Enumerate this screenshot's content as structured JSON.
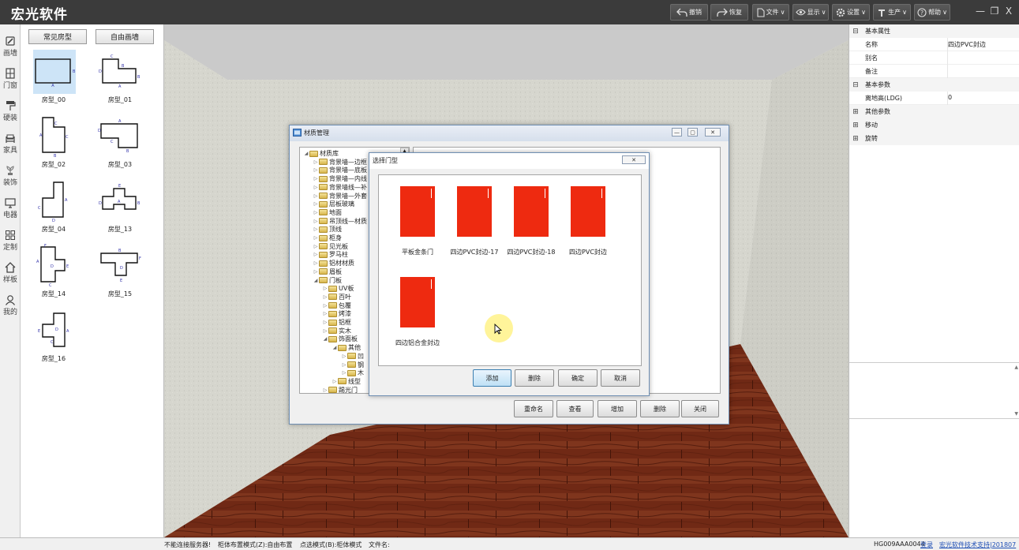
{
  "app": {
    "title": "宏光软件"
  },
  "toolbar": {
    "undo": "撤销",
    "redo": "恢复",
    "file": "文件",
    "display": "显示",
    "settings": "设置",
    "production": "生产",
    "help": "帮助"
  },
  "window_controls": {
    "minimize": "—",
    "maximize": "❐",
    "close": "X"
  },
  "left_nav": {
    "items": [
      "画墙",
      "门窗",
      "硬装",
      "家具",
      "装饰",
      "电器",
      "定制",
      "样板",
      "我的"
    ]
  },
  "room_panel": {
    "tabs": [
      "常见房型",
      "自由画墙"
    ],
    "rooms": [
      "房型_00",
      "房型_01",
      "房型_02",
      "房型_03",
      "房型_04",
      "房型_13",
      "房型_14",
      "房型_15",
      "房型_16"
    ]
  },
  "material_dialog": {
    "title": "材质管理",
    "tree": [
      "材质库",
      "背景墙—边框",
      "背景墙—底板",
      "背景墙—内线",
      "背景墙线—补",
      "背景墙—外套",
      "层板玻璃",
      "地面",
      "吊顶线—材质",
      "顶线",
      "柜身",
      "见光板",
      "罗马柱",
      "铝材材质",
      "眉板",
      "门板",
      "UV板",
      "百叶",
      "包覆",
      "烤漆",
      "铝框",
      "实木",
      "饰面板",
      "其他",
      "凹",
      "钢",
      "木",
      "线型",
      "踢光门"
    ],
    "buttons": [
      "重命名",
      "查看",
      "增加",
      "删除",
      "关闭"
    ]
  },
  "door_dialog": {
    "title": "选择门型",
    "doors": [
      "平板金条门",
      "四边PVC封边-17",
      "四边PVC封边-18",
      "四边PVC封边",
      "四边铝合金封边"
    ],
    "buttons": [
      "添加",
      "删除",
      "确定",
      "取消"
    ],
    "door_color": "#ee2a10"
  },
  "properties": {
    "group_basic": "基本属性",
    "name_key": "名称",
    "name_val": "四边PVC封边",
    "alias_key": "别名",
    "remark_key": "备注",
    "group_params": "基本参数",
    "height_key": "离地高(LDG)",
    "height_val": "0",
    "group_other": "其他参数",
    "group_move": "移动",
    "group_rotate": "旋转"
  },
  "status": {
    "server": "不能连接服务器!",
    "cabinet_mode": "柜体布置模式(Z):自由布置",
    "select_mode": "点选模式(B):柜体模式",
    "filename": "文件名:",
    "code": "HG009AAA0044",
    "login": "登录",
    "support": "宏光软件技术支持|201807"
  }
}
